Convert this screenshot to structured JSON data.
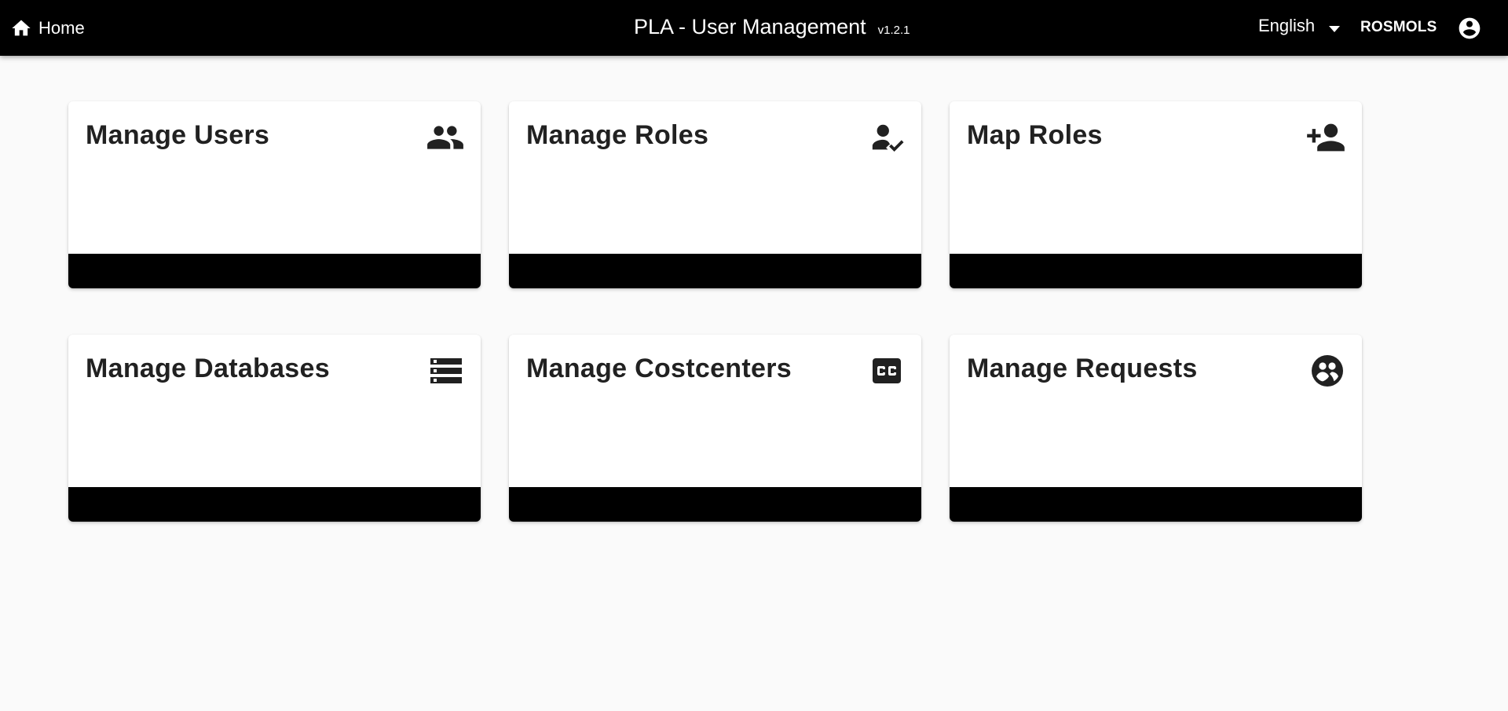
{
  "header": {
    "home_label": "Home",
    "title": "PLA - User Management",
    "version": "v1.2.1",
    "language": "English",
    "username": "ROSMOLS"
  },
  "cards": [
    {
      "title": "Manage Users",
      "icon": "users-icon"
    },
    {
      "title": "Manage Roles",
      "icon": "user-check-icon"
    },
    {
      "title": "Map Roles",
      "icon": "person-add-icon"
    },
    {
      "title": "Manage Databases",
      "icon": "storage-icon"
    },
    {
      "title": "Manage Costcenters",
      "icon": "closed-caption-icon"
    },
    {
      "title": "Manage Requests",
      "icon": "requests-icon"
    }
  ],
  "colors": {
    "topbar": "#000000",
    "background": "#fafafa",
    "card": "#ffffff",
    "card_footer": "#000000",
    "text": "#212121"
  }
}
